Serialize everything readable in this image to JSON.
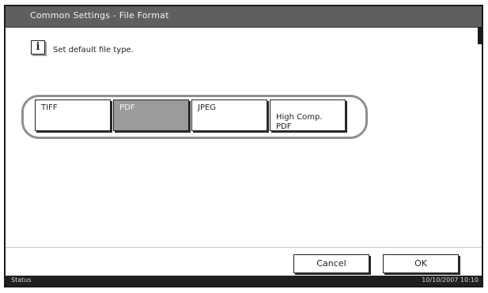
{
  "window": {
    "title": "Common Settings - File Format"
  },
  "message": {
    "icon": "info-icon",
    "text": "Set default file type."
  },
  "file_types": [
    {
      "label": "TIFF",
      "selected": false
    },
    {
      "label": "PDF",
      "selected": true
    },
    {
      "label": "JPEG",
      "selected": false
    },
    {
      "label": "High Comp.\nPDF",
      "selected": false
    }
  ],
  "actions": {
    "cancel": "Cancel",
    "ok": "OK"
  },
  "status": {
    "label": "Status",
    "datetime": "10/10/2007  10:10"
  },
  "colors": {
    "titlebar": "#5f5f5f",
    "selected": "#9b9b9b",
    "statusbar": "#1f1f1f"
  }
}
